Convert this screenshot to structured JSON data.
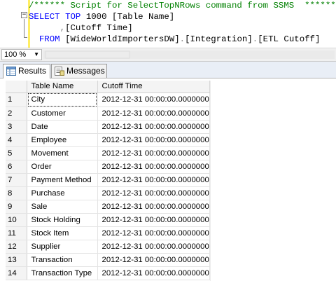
{
  "editor": {
    "line1_comment": "/****** Script for SelectTopNRows command from SSMS  ******/",
    "line2_kw_select": "SELECT",
    "line2_kw_top": "TOP",
    "line2_num": "1000",
    "line2_col": "[Table Name]",
    "line3_comma": ",",
    "line3_col": "[Cutoff Time]",
    "line4_kw_from": "FROM",
    "line4_db": "[WideWorldImportersDW]",
    "line4_dot1": ".",
    "line4_schema": "[Integration]",
    "line4_dot2": ".",
    "line4_table": "[ETL Cutoff]",
    "collapse_glyph": "−"
  },
  "zoom": {
    "value": "100 %"
  },
  "tabs": [
    {
      "label": "Results",
      "icon": "grid-icon",
      "selected": true
    },
    {
      "label": "Messages",
      "icon": "messages-icon",
      "selected": false
    }
  ],
  "grid": {
    "columns": [
      "Table Name",
      "Cutoff Time"
    ],
    "rows": [
      {
        "n": "1",
        "name": "City",
        "time": "2012-12-31 00:00:00.0000000"
      },
      {
        "n": "2",
        "name": "Customer",
        "time": "2012-12-31 00:00:00.0000000"
      },
      {
        "n": "3",
        "name": "Date",
        "time": "2012-12-31 00:00:00.0000000"
      },
      {
        "n": "4",
        "name": "Employee",
        "time": "2012-12-31 00:00:00.0000000"
      },
      {
        "n": "5",
        "name": "Movement",
        "time": "2012-12-31 00:00:00.0000000"
      },
      {
        "n": "6",
        "name": "Order",
        "time": "2012-12-31 00:00:00.0000000"
      },
      {
        "n": "7",
        "name": "Payment Method",
        "time": "2012-12-31 00:00:00.0000000"
      },
      {
        "n": "8",
        "name": "Purchase",
        "time": "2012-12-31 00:00:00.0000000"
      },
      {
        "n": "9",
        "name": "Sale",
        "time": "2012-12-31 00:00:00.0000000"
      },
      {
        "n": "10",
        "name": "Stock Holding",
        "time": "2012-12-31 00:00:00.0000000"
      },
      {
        "n": "11",
        "name": "Stock Item",
        "time": "2012-12-31 00:00:00.0000000"
      },
      {
        "n": "12",
        "name": "Supplier",
        "time": "2012-12-31 00:00:00.0000000"
      },
      {
        "n": "13",
        "name": "Transaction",
        "time": "2012-12-31 00:00:00.0000000"
      },
      {
        "n": "14",
        "name": "Transaction Type",
        "time": "2012-12-31 00:00:00.0000000"
      }
    ]
  },
  "colors": {
    "keyword": "#0000ff",
    "comment": "#008000",
    "operator": "#808080",
    "change_marker": "#ffee62"
  }
}
